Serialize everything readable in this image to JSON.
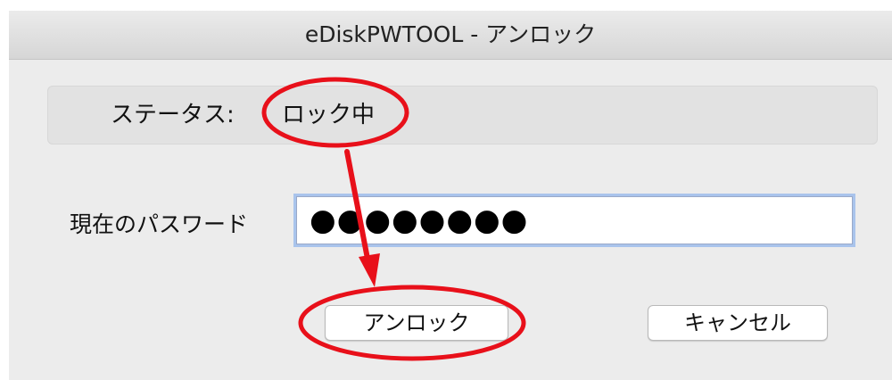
{
  "window": {
    "title": "eDiskPWTOOL - アンロック"
  },
  "status": {
    "label": "ステータス:",
    "value": "ロック中"
  },
  "password": {
    "label": "現在のパスワード",
    "masked_value": "●●●●●●●●"
  },
  "buttons": {
    "unlock_label": "アンロック",
    "cancel_label": "キャンセル"
  },
  "annotation_color": "#e8101a"
}
